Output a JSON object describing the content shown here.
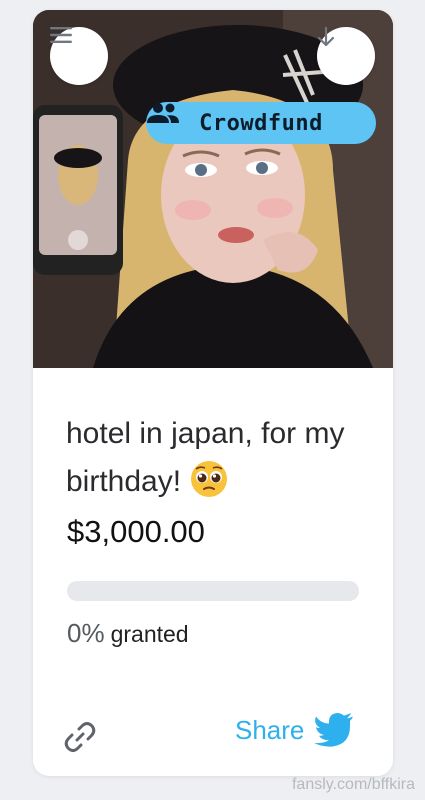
{
  "card": {
    "badge_label": "Crowdfund",
    "title": "hotel in japan, for my birthday!",
    "title_emoji": "pleading-face-emoji",
    "price": "$3,000.00",
    "progress_percent": 0,
    "progress_label": "0%",
    "granted_label": "granted",
    "share_label": "Share"
  },
  "icons": {
    "menu": "hamburger-menu-icon",
    "download": "arrow-down-icon",
    "group": "group-people-icon",
    "link": "link-icon",
    "share": "twitter-bird-icon"
  },
  "colors": {
    "accent": "#5ec4f4",
    "share_text": "#2fb0ee",
    "page_background": "#eeeff3"
  },
  "footer": {
    "watermark": "fansly.com/bffkira"
  }
}
